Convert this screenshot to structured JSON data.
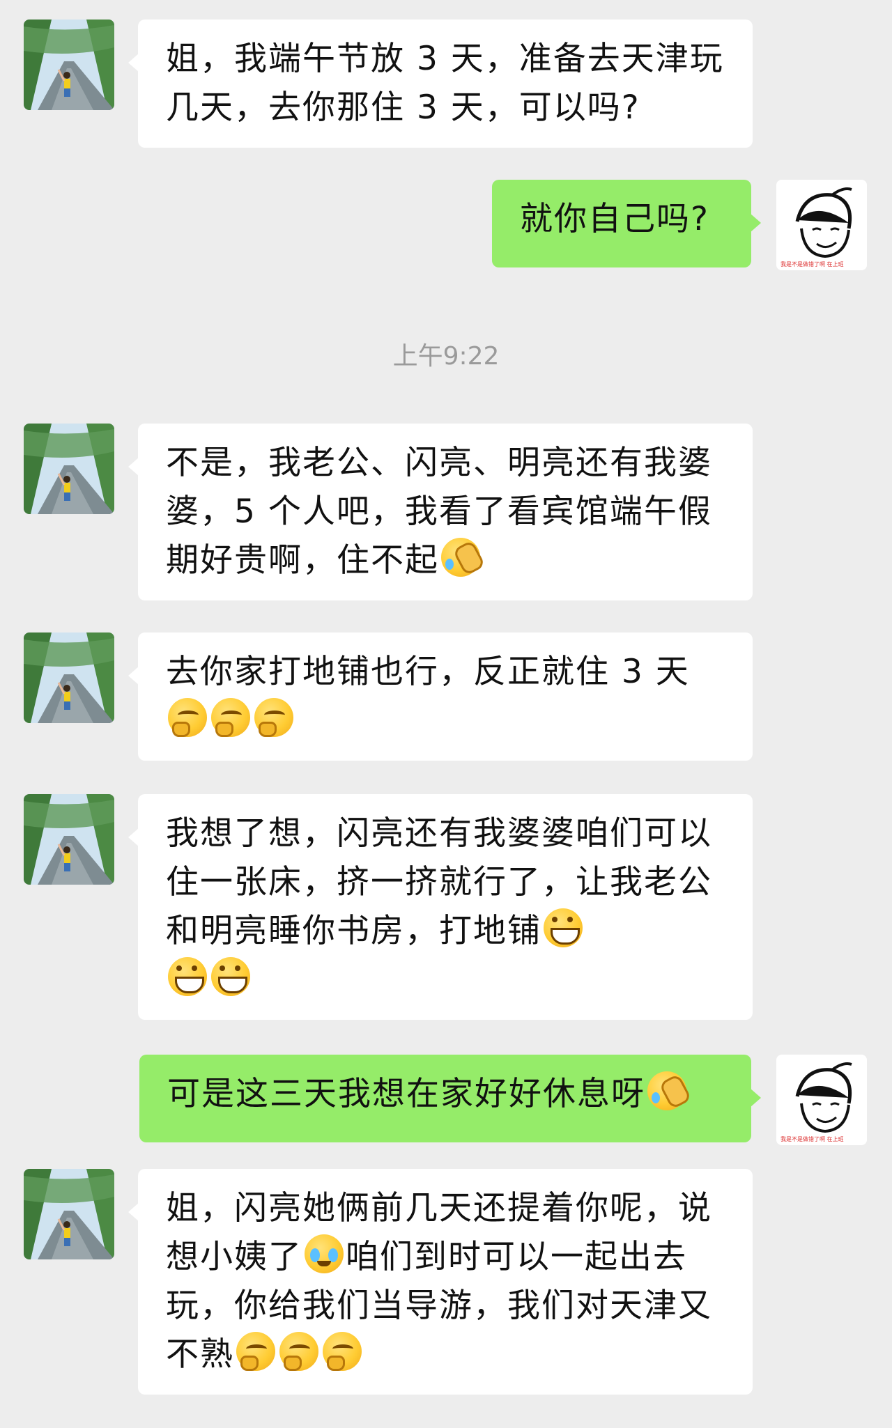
{
  "conversation": {
    "timestamp": "上午9:22",
    "messages": [
      {
        "sender": "contact",
        "text": "姐，我端午节放 3 天，准备去天津玩几天，去你那住 3 天，可以吗?"
      },
      {
        "sender": "self",
        "text": "就你自己吗?"
      },
      {
        "sender": "contact",
        "text": "不是，我老公、闪亮、明亮还有我婆婆，5 个人吧，我看了看宾馆端午假期好贵啊，住不起"
      },
      {
        "sender": "contact",
        "text": "去你家打地铺也行，反正就住 3 天"
      },
      {
        "sender": "contact",
        "text": "我想了想，闪亮还有我婆婆咱们可以住一张床，挤一挤就行了，让我老公和明亮睡你书房，打地铺"
      },
      {
        "sender": "self",
        "text": "可是这三天我想在家好好休息呀"
      },
      {
        "sender": "contact",
        "text_a": "姐，闪亮她俩前几天还提着你呢，说想小姨了",
        "text_b": "咱们到时可以一起出去玩，你给我们当导游，我们对天津又不熟"
      }
    ]
  },
  "avatars": {
    "contact": "landscape-girl-photo",
    "self": "cartoon-girl-drawing",
    "self_caption": "我是不是做错了啊 在上班"
  },
  "colors": {
    "background": "#ededed",
    "incoming_bubble": "#ffffff",
    "outgoing_bubble": "#95ec69",
    "timestamp": "#9a9a9a"
  },
  "emoji": {
    "facepalm": "facepalm-emoji",
    "think": "thinking-emoji",
    "grin": "grin-emoji",
    "cry_laugh": "tears-of-joy-emoji"
  }
}
